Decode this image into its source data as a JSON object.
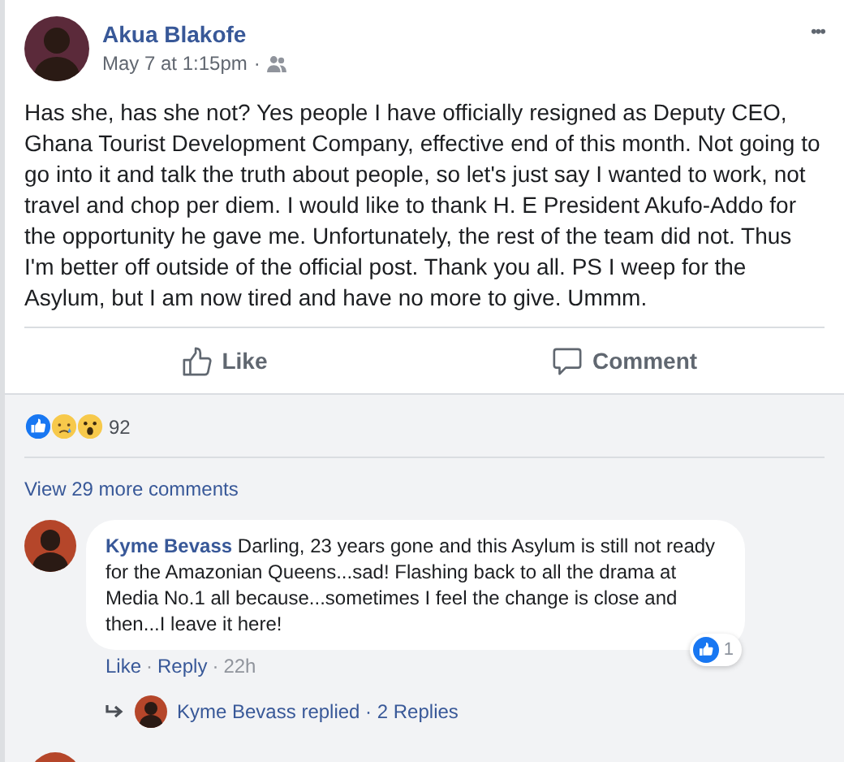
{
  "post": {
    "author": "Akua Blakofe",
    "time": "May 7 at 1:15pm",
    "separator": "·",
    "menu": "•••",
    "text": "Has she, has she not? Yes people I have officially resigned as Deputy CEO, Ghana Tourist Development Company, effective end of this month. Not going to go into it and talk the truth about people, so let's just say I wanted to work, not travel and chop per diem. I would like to thank H. E President Akufo-Addo for the opportunity he gave me. Unfortunately, the rest of the team did not. Thus I'm better off outside of the official post. Thank you all. PS I weep for the Asylum, but I am now tired and have no more to give. Ummm.",
    "actions": [
      {
        "label": "Like",
        "kind": "like"
      },
      {
        "label": "Comment",
        "kind": "comment"
      }
    ],
    "reactions": {
      "count": "92"
    }
  },
  "view_more": "View 29 more comments",
  "comments": [
    {
      "author": "Kyme Bevass",
      "text": "Darling, 23 years gone and this Asylum is still not ready for the Amazonian Queens...sad! Flashing back to all the drama at Media No.1 all because...sometimes I feel the change is close and then...I leave it here!",
      "like_count": "1",
      "meta": [
        {
          "label": "Like",
          "kind": "link"
        },
        {
          "label": "·",
          "kind": "sep"
        },
        {
          "label": "Reply",
          "kind": "link"
        },
        {
          "label": "·",
          "kind": "sep"
        },
        {
          "label": "22h",
          "kind": "time"
        }
      ],
      "replies": "Kyme Bevass replied · 2 Replies"
    }
  ]
}
